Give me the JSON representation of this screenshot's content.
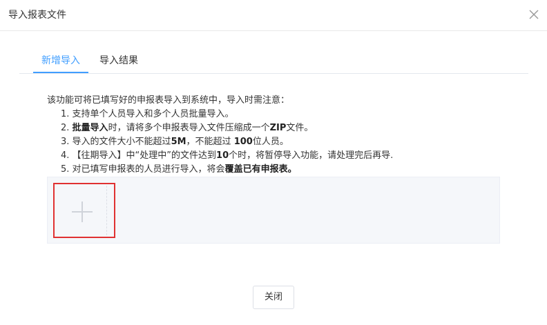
{
  "dialog": {
    "title": "导入报表文件",
    "close_icon": "close-x-icon"
  },
  "tabs": [
    {
      "label": "新增导入",
      "active": true
    },
    {
      "label": "导入结果",
      "active": false
    }
  ],
  "notice": {
    "intro": "该功能可将已填写好的申报表导入到系统中，导入时需注意：",
    "items": [
      {
        "number": "1.",
        "text": "支持单个人员导入和多个人员批量导入。"
      },
      {
        "number": "2.",
        "bold1": "批量导入",
        "text1": "时，请将多个申报表导入文件压缩成一个",
        "bold2": "ZIP",
        "text2": "文件。"
      },
      {
        "number": "3.",
        "text1": "导入的文件大小不能超过",
        "bold1": "5M",
        "text2": "，不能超过 ",
        "bold2": "100",
        "text3": "位人员。"
      },
      {
        "number": "4.",
        "text1": "【往期导入】中“处理中”的文件达到",
        "bold1": "10",
        "text2": "个时，将暂停导入功能，请处理完后再导."
      },
      {
        "number": "5.",
        "text1": "对已填写申报表的人员进行导入，将会",
        "bold1": "覆盖已有申报表。"
      }
    ]
  },
  "upload": {
    "icon": "plus-icon"
  },
  "footer": {
    "close_label": "关闭"
  },
  "colors": {
    "accent": "#409eff",
    "highlight_border": "#e03131",
    "upload_bg": "#f5f7fa"
  }
}
